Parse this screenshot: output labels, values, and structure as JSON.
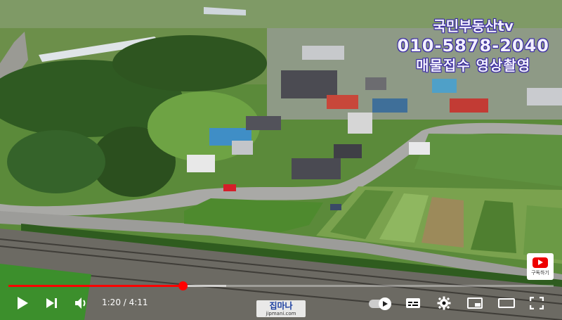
{
  "overlay": {
    "line1": "국민부동산tv",
    "line2": "010-5878-2040",
    "line3": "매물접수 영상촬영"
  },
  "subscribe": {
    "label": "구독하기"
  },
  "watermark": {
    "brand": "집마나",
    "url": "jipmani.com"
  },
  "player": {
    "current_time": "1:20",
    "duration": "4:11",
    "time_display": "1:20 / 4:11",
    "played_fraction": 0.319,
    "loaded_fraction": 0.4,
    "autoplay_on": true
  },
  "icons": {
    "play": "play-icon",
    "next": "next-icon",
    "volume": "volume-icon",
    "autoplay": "autoplay-toggle",
    "captions": "captions-icon",
    "settings": "gear-icon",
    "miniplayer": "miniplayer-icon",
    "theater": "theater-icon",
    "fullscreen": "fullscreen-icon"
  },
  "colors": {
    "progress_played": "#ff0000",
    "overlay_text": "#f2f0ff",
    "overlay_outline": "#3b2bb0"
  }
}
